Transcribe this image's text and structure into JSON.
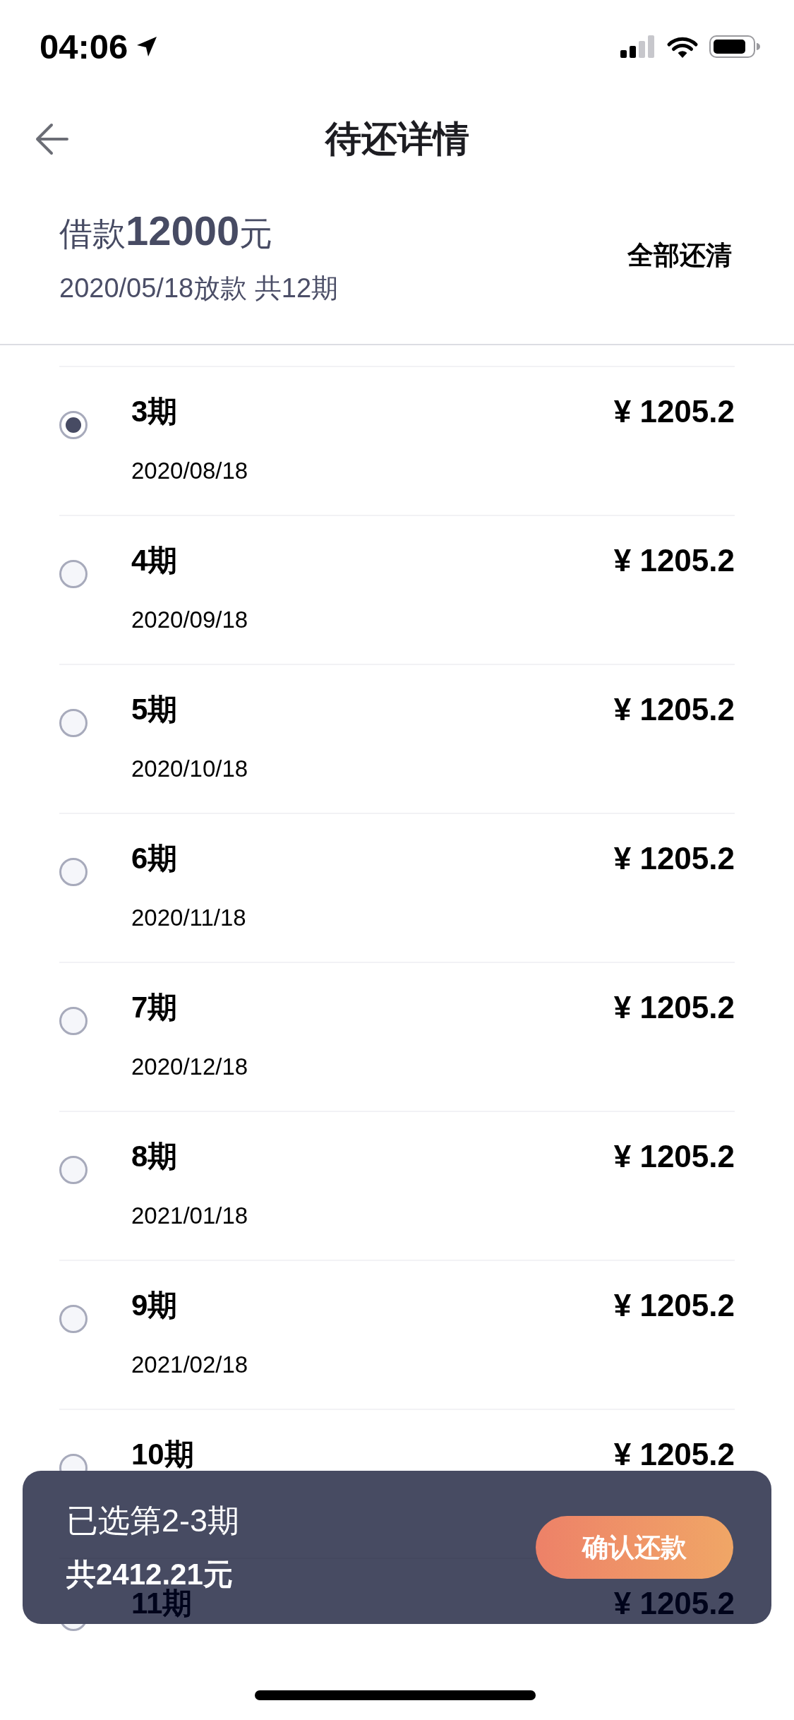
{
  "status_bar": {
    "time": "04:06"
  },
  "nav": {
    "title": "待还详情"
  },
  "loan": {
    "amount": "借款**12000**元",
    "info": "2020/05/18放款 共12期",
    "pay_off_button": "全部还清"
  },
  "installments": [
    {
      "label": "3期",
      "date": "2020/08/18",
      "amount": "¥ 1205.2",
      "selected": true
    },
    {
      "label": "4期",
      "date": "2020/09/18",
      "amount": "¥ 1205.2",
      "selected": false
    },
    {
      "label": "5期",
      "date": "2020/10/18",
      "amount": "¥ 1205.2",
      "selected": false
    },
    {
      "label": "6期",
      "date": "2020/11/18",
      "amount": "¥ 1205.2",
      "selected": false
    },
    {
      "label": "7期",
      "date": "2020/12/18",
      "amount": "¥ 1205.2",
      "selected": false
    },
    {
      "label": "8期",
      "date": "2021/01/18",
      "amount": "¥ 1205.2",
      "selected": false
    },
    {
      "label": "9期",
      "date": "2021/02/18",
      "amount": "¥ 1205.2",
      "selected": false
    },
    {
      "label": "10期",
      "amount": "¥ 1205.2",
      "selected": false
    },
    {
      "label": "11期",
      "amount": "¥ 1205.2",
      "selected": false
    }
  ],
  "summary": {
    "selection": "已选第2-3期",
    "total": "共2412.21元",
    "confirm_button": "确认还款"
  }
}
